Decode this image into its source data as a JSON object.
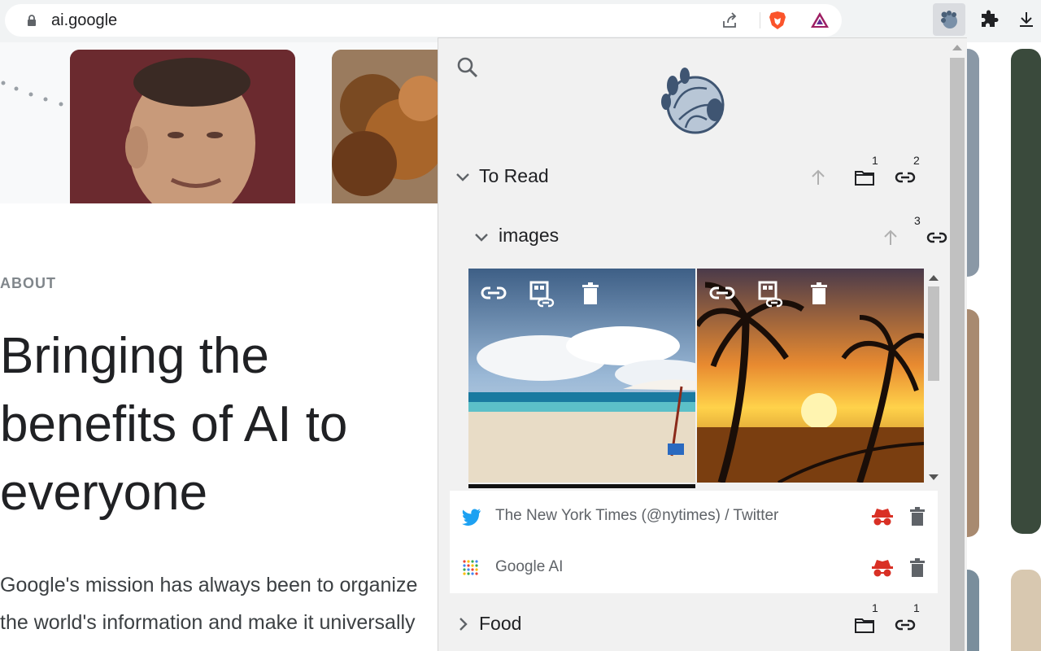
{
  "browser": {
    "url": "ai.google"
  },
  "page": {
    "about_label": "ABOUT",
    "headline": "Bringing the benefits of AI to everyone",
    "mission_line1": "Google's mission has always been to organize",
    "mission_line2": "the world's information and make it universally"
  },
  "popup": {
    "folders": [
      {
        "title": "To Read",
        "folder_count": "1",
        "link_count": "2",
        "expanded": true
      },
      {
        "title": "Food",
        "folder_count": "1",
        "link_count": "1",
        "expanded": false
      }
    ],
    "subfolder": {
      "title": "images",
      "link_count": "3",
      "expanded": true
    },
    "links": [
      {
        "title": "The New York Times (@nytimes) / Twitter",
        "favicon": "twitter-icon"
      },
      {
        "title": "Google AI",
        "favicon": "google-ai-icon"
      }
    ]
  },
  "colors": {
    "chrome_bg": "#f1f3f4",
    "popup_bg": "#f1f1f1",
    "incognito_red": "#d93025",
    "twitter_blue": "#1da1f2",
    "brave_orange": "#fb542b"
  }
}
